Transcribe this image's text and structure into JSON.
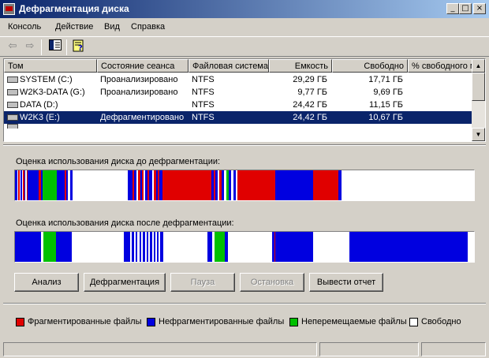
{
  "window": {
    "title": "Дефрагментация диска",
    "controls": {
      "minimize": "_",
      "maximize": "□",
      "close": "×"
    }
  },
  "menu": [
    "Консоль",
    "Действие",
    "Вид",
    "Справка"
  ],
  "toolbar": {
    "icons": [
      "back-arrow-icon",
      "forward-arrow-icon",
      "show-hide-tree-icon",
      "help-icon"
    ],
    "glyphs": {
      "back": "⇦",
      "forward": "⇨"
    }
  },
  "volumes": {
    "columns": [
      "Том",
      "Состояние сеанса",
      "Файловая система",
      "Емкость",
      "Свободно",
      "% свободного м"
    ],
    "rows": [
      {
        "name": "SYSTEM (C:)",
        "status": "Проанализировано",
        "fs": "NTFS",
        "capacity": "29,29 ГБ",
        "free": "17,71 ГБ",
        "selected": false
      },
      {
        "name": "W2K3-DATA (G:)",
        "status": "Проанализировано",
        "fs": "NTFS",
        "capacity": "9,77 ГБ",
        "free": "9,69 ГБ",
        "selected": false
      },
      {
        "name": "DATA (D:)",
        "status": "",
        "fs": "NTFS",
        "capacity": "24,42 ГБ",
        "free": "11,15 ГБ",
        "selected": false
      },
      {
        "name": "W2K3 (E:)",
        "status": "Дефрагментировано",
        "fs": "NTFS",
        "capacity": "24,42 ГБ",
        "free": "10,67 ГБ",
        "selected": true
      }
    ],
    "scroll_arrows": {
      "up": "▲",
      "down": "▼"
    }
  },
  "before": {
    "label": "Оценка использования диска до дефрагментации:"
  },
  "after": {
    "label": "Оценка использования диска после дефрагментации:"
  },
  "buttons": [
    {
      "label": "Анализ",
      "enabled": true
    },
    {
      "label": "Дефрагментация",
      "enabled": true
    },
    {
      "label": "Пауза",
      "enabled": false
    },
    {
      "label": "Остановка",
      "enabled": false
    },
    {
      "label": "Вывести отчет",
      "enabled": true
    }
  ],
  "legend": [
    {
      "label": "Фрагментированные файлы",
      "color": "#e00000"
    },
    {
      "label": "Нефрагментированные файлы",
      "color": "#0000e0"
    },
    {
      "label": "Неперемещаемые файлы",
      "color": "#00c000"
    },
    {
      "label": "Свободно",
      "color": "#ffffff"
    }
  ],
  "colors": {
    "fragmented": "#e00000",
    "contiguous": "#0000e0",
    "unmovable": "#00c000",
    "free": "#ffffff",
    "selection": "#0a246a"
  }
}
